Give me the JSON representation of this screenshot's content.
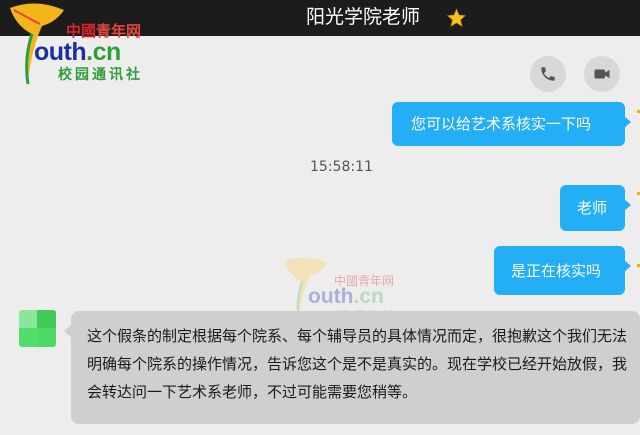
{
  "header": {
    "contact_name": "阳光学院老师",
    "favorite_icon": "star-icon"
  },
  "logo": {
    "brand_cn_1": "中國",
    "brand_cn_2": "青年网",
    "brand_en_1": "outh",
    "brand_en_2": ".cn",
    "brand_sub": "校园通讯社"
  },
  "actions": {
    "call_icon": "phone-icon",
    "video_icon": "video-camera-icon"
  },
  "messages": [
    {
      "direction": "outgoing",
      "text": "您可以给艺术系核实一下吗"
    },
    {
      "direction": "timestamp",
      "text": "15:58:11"
    },
    {
      "direction": "outgoing",
      "text": "老师"
    },
    {
      "direction": "outgoing",
      "text": "是正在核实吗"
    },
    {
      "direction": "incoming",
      "text": "这个假条的制定根据每个院系、每个辅导员的具体情况而定，很抱歉这个我们无法明确每个院系的操作情况，告诉您这个是不是真实的。现在学校已经开始放假，我会转达问一下艺术系老师，不过可能需要您稍等。"
    }
  ],
  "colors": {
    "outgoing_bubble": "#23aef6",
    "incoming_bubble": "#cfcfcf",
    "topbar": "#1c1c1c",
    "avatar": "#4cd964"
  }
}
